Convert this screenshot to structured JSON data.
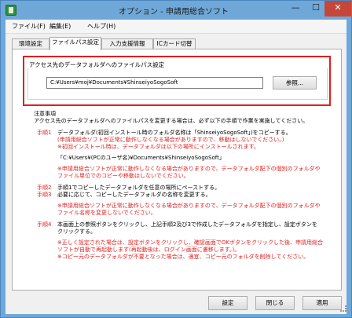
{
  "window": {
    "title": "オプション - 申請用総合ソフト",
    "min_glyph": "—",
    "max_glyph": "☐",
    "close_glyph": "✕"
  },
  "menu": {
    "file": "ファイル(F)",
    "edit": "編集(E)",
    "help": "ヘルプ(H)"
  },
  "tabs": {
    "env": "環境設定",
    "path": "ファイルパス設定",
    "input": "入力支援情報",
    "ic": "ICカード切替",
    "active": "ファイルパス設定"
  },
  "path_group": {
    "label": "アクセス先のデータフォルダへのファイルパス設定",
    "value": "C:¥Users¥moj¥Documents¥ShinseiyoSogoSoft",
    "browse": "参照..."
  },
  "notes": {
    "heading": "注意事項",
    "intro": "アクセス先のデータフォルダへのファイルパスを変更する場合は、必ず以下の手順で作業を実施してください。",
    "step1_label": "手順1",
    "step1_line1": "データフォルダ(初回インストール時のフォルダ名称は「ShinseiyoSogoSoft」)をコピーする。",
    "step1_red1": "(申請用総合ソフトが正常に動作しなくなる場合がありますので、移動はしないでください。)",
    "step1_red2": "※初回インストール時は、データフォルダは以下の場所にインストールされます。",
    "step1_path": "「C:¥Users¥(PCのユーザ名)¥Documents¥ShinseiyoSogoSoft」",
    "step1_warn1": "※申請用総合ソフトが正常に動作しなくなる場合がありますので、データフォルダ配下の個別のフォルダや",
    "step1_warn2": "ファイル単位でのコピーや移動はしないでください。",
    "step2_label": "手順2",
    "step2_text": "手順1でコピーしたデータフォルダを任意の場所にペーストする。",
    "step3_label": "手順3",
    "step3_text": "必要に応じて、コピーしたデータフォルダの名称を変更する。",
    "step3_red1": "※申請用総合ソフトが正常に動作しなくなる場合がありますので、データフォルダ配下の個別のフォルダや",
    "step3_red2": "ファイル名称を変更しないでください。",
    "step4_label": "手順4",
    "step4_line1": "本画面上の参照ボタンをクリックし、上記手順2及び3で作成したデータフォルダを指定し、設定ボタンを",
    "step4_line2": "クリックする。",
    "step4_red1": "※正しく設定された場合は、設定ボタンをクリックし、確認画面でOKボタンをクリックした後、申請用総合",
    "step4_red2": "ソフトが自動で再起動します(再起動後は、ログイン画面に遷移します。)。",
    "step4_red3": "※コピー元のデータフォルダが不要となった場合は、適宜、コピー元のフォルダを削除してください。"
  },
  "footer": {
    "set": "設定",
    "close": "閉じる",
    "apply": "適用"
  },
  "colors": {
    "title_bar": "#6fa8d8",
    "accent_red": "#e01f1f",
    "close_button": "#c7463a"
  }
}
